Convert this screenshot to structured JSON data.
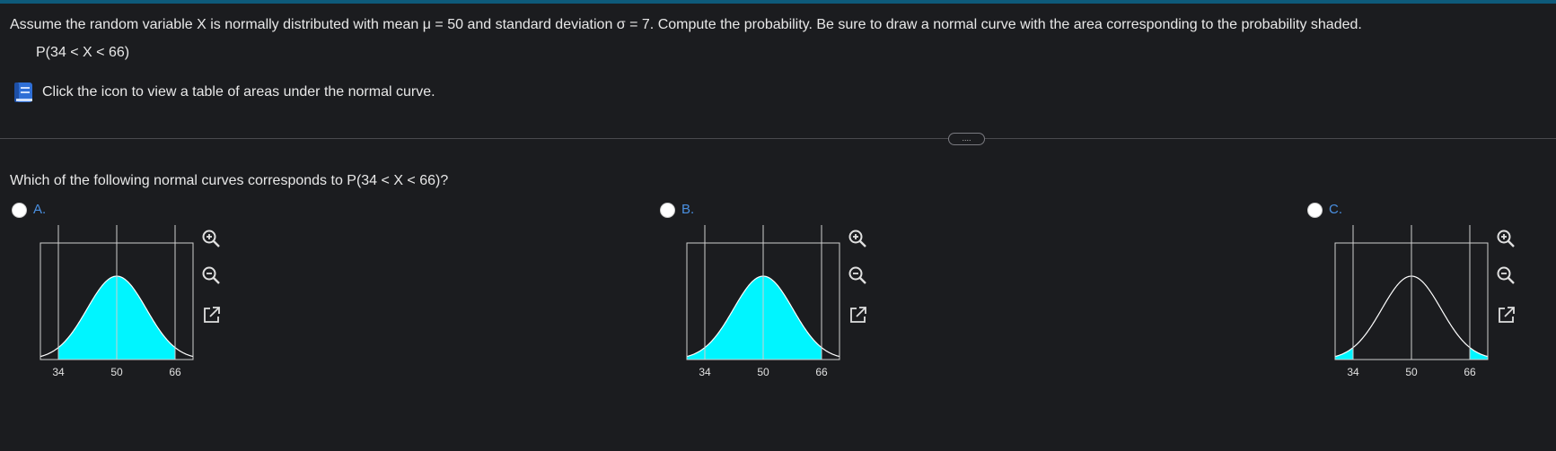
{
  "problem": {
    "text": "Assume the random variable X is normally distributed with mean μ = 50 and standard deviation σ = 7. Compute the probability. Be sure to draw a normal curve with the area corresponding to the probability shaded.",
    "expression": "P(34 < X < 66)",
    "table_link": "Click the icon to view a table of areas under the normal curve."
  },
  "more_button": "....",
  "question": "Which of the following normal curves corresponds to P(34 < X < 66)?",
  "options": [
    {
      "label": "A.",
      "ticks": [
        "34",
        "50",
        "66"
      ],
      "shading": "between"
    },
    {
      "label": "B.",
      "ticks": [
        "34",
        "50",
        "66"
      ],
      "shading": "left-of-upper"
    },
    {
      "label": "C.",
      "ticks": [
        "34",
        "50",
        "66"
      ],
      "shading": "tails"
    }
  ],
  "colors": {
    "accent": "#4a90e2",
    "shade": "#00f5ff",
    "background": "#1b1c1f",
    "topbar": "#0e5a7a"
  },
  "icons": [
    "book-icon",
    "zoom-in-icon",
    "zoom-out-icon",
    "open-external-icon"
  ]
}
